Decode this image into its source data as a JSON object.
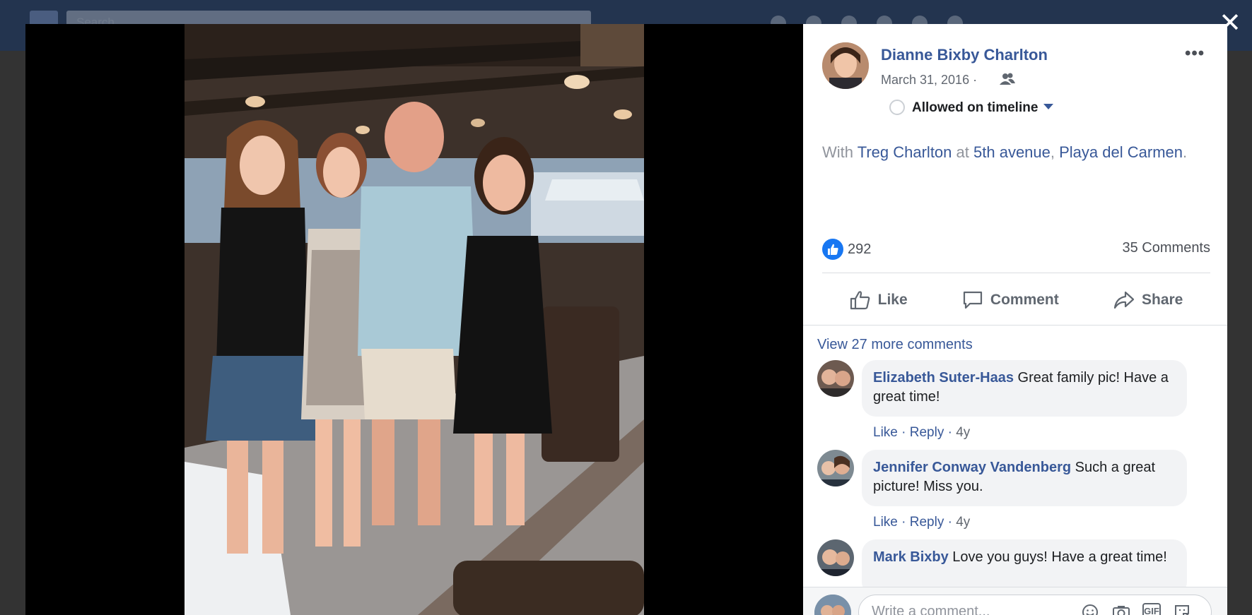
{
  "background_page": {
    "search_placeholder": "Search"
  },
  "post": {
    "author": "Dianne Bixby Charlton",
    "date": "March 31, 2016",
    "timeline_status": "Allowed on timeline",
    "caption_with": "With",
    "caption_person": "Treg Charlton",
    "caption_at": "at",
    "caption_place1": "5th avenue",
    "caption_place2": "Playa del Carmen",
    "caption_end": ".",
    "like_count": "292",
    "comment_count": "35 Comments",
    "actions": {
      "like": "Like",
      "comment": "Comment",
      "share": "Share"
    },
    "view_more": "View 27 more comments"
  },
  "comments": [
    {
      "name": "Elizabeth Suter-Haas",
      "text": "Great family pic! Have a great time!",
      "like": "Like",
      "reply": "Reply",
      "time": "4y"
    },
    {
      "name": "Jennifer Conway Vandenberg",
      "text": "Such a great picture! Miss you.",
      "like": "Like",
      "reply": "Reply",
      "time": "4y"
    },
    {
      "name": "Mark Bixby",
      "text": "Love you guys! Have a great time!",
      "like": "",
      "reply": "",
      "time": ""
    }
  ],
  "composer": {
    "placeholder": "Write a comment...",
    "icons": [
      "emoji-icon",
      "camera-icon",
      "gif-icon",
      "sticker-icon"
    ],
    "gif_label": "GIF"
  },
  "colors": {
    "link": "#385898",
    "like_blue": "#1877f2",
    "panel_bg": "#ffffff"
  }
}
